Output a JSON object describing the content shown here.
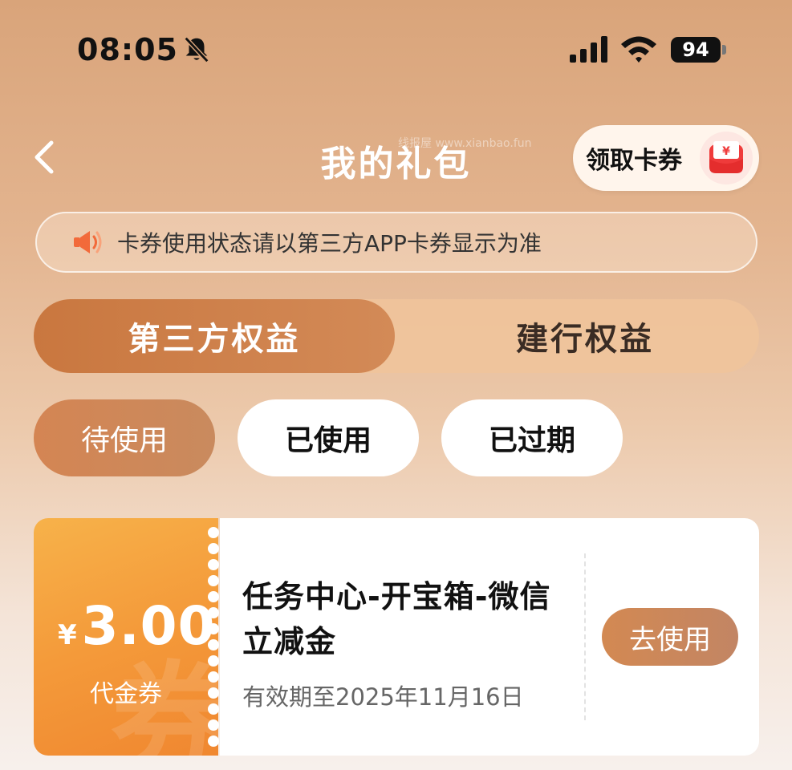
{
  "status_bar": {
    "time": "08:05",
    "battery": "94",
    "icons": [
      "bell-muted-icon",
      "signal-icon",
      "wifi-icon",
      "battery-icon"
    ]
  },
  "header": {
    "title": "我的礼包",
    "claim_button_label": "领取卡券",
    "watermark": "线报屋 www.xianbao.fun"
  },
  "notice": {
    "text": "卡券使用状态请以第三方APP卡券显示为准",
    "icon": "speaker-icon"
  },
  "tabs": [
    {
      "label": "第三方权益",
      "active": true
    },
    {
      "label": "建行权益",
      "active": false
    }
  ],
  "filters": [
    {
      "label": "待使用",
      "active": true
    },
    {
      "label": "已使用",
      "active": false
    },
    {
      "label": "已过期",
      "active": false
    }
  ],
  "coupon": {
    "currency": "¥",
    "amount": "3.00",
    "type": "代金券",
    "bg_char": "券",
    "title": "任务中心-开宝箱-微信立减金",
    "validity": "有效期至2025年11月16日",
    "action_label": "去使用"
  },
  "colors": {
    "accent": "#d08448",
    "coupon_orange": "#f49a3a",
    "notice_speaker": "#f26a3a"
  }
}
